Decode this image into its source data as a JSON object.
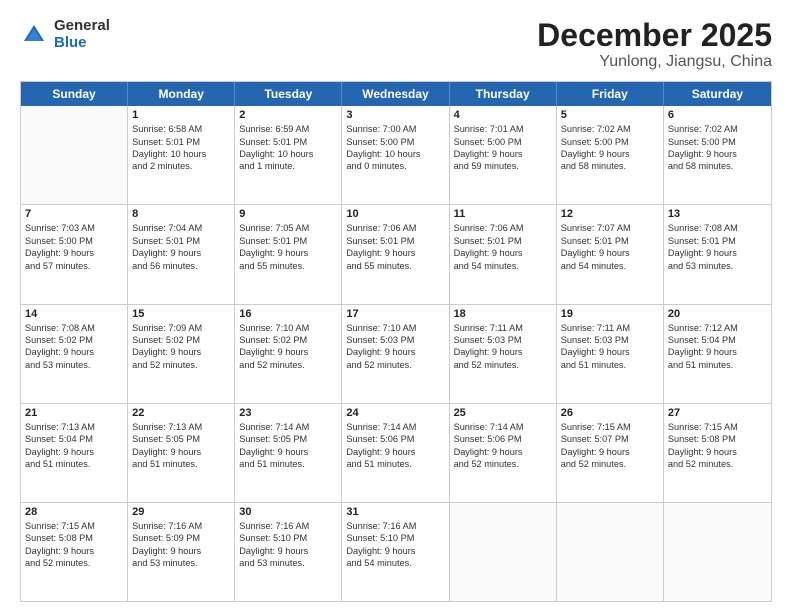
{
  "logo": {
    "general": "General",
    "blue": "Blue"
  },
  "title": "December 2025",
  "subtitle": "Yunlong, Jiangsu, China",
  "weekdays": [
    "Sunday",
    "Monday",
    "Tuesday",
    "Wednesday",
    "Thursday",
    "Friday",
    "Saturday"
  ],
  "weeks": [
    [
      {
        "day": "",
        "lines": []
      },
      {
        "day": "1",
        "lines": [
          "Sunrise: 6:58 AM",
          "Sunset: 5:01 PM",
          "Daylight: 10 hours",
          "and 2 minutes."
        ]
      },
      {
        "day": "2",
        "lines": [
          "Sunrise: 6:59 AM",
          "Sunset: 5:01 PM",
          "Daylight: 10 hours",
          "and 1 minute."
        ]
      },
      {
        "day": "3",
        "lines": [
          "Sunrise: 7:00 AM",
          "Sunset: 5:00 PM",
          "Daylight: 10 hours",
          "and 0 minutes."
        ]
      },
      {
        "day": "4",
        "lines": [
          "Sunrise: 7:01 AM",
          "Sunset: 5:00 PM",
          "Daylight: 9 hours",
          "and 59 minutes."
        ]
      },
      {
        "day": "5",
        "lines": [
          "Sunrise: 7:02 AM",
          "Sunset: 5:00 PM",
          "Daylight: 9 hours",
          "and 58 minutes."
        ]
      },
      {
        "day": "6",
        "lines": [
          "Sunrise: 7:02 AM",
          "Sunset: 5:00 PM",
          "Daylight: 9 hours",
          "and 58 minutes."
        ]
      }
    ],
    [
      {
        "day": "7",
        "lines": [
          "Sunrise: 7:03 AM",
          "Sunset: 5:00 PM",
          "Daylight: 9 hours",
          "and 57 minutes."
        ]
      },
      {
        "day": "8",
        "lines": [
          "Sunrise: 7:04 AM",
          "Sunset: 5:01 PM",
          "Daylight: 9 hours",
          "and 56 minutes."
        ]
      },
      {
        "day": "9",
        "lines": [
          "Sunrise: 7:05 AM",
          "Sunset: 5:01 PM",
          "Daylight: 9 hours",
          "and 55 minutes."
        ]
      },
      {
        "day": "10",
        "lines": [
          "Sunrise: 7:06 AM",
          "Sunset: 5:01 PM",
          "Daylight: 9 hours",
          "and 55 minutes."
        ]
      },
      {
        "day": "11",
        "lines": [
          "Sunrise: 7:06 AM",
          "Sunset: 5:01 PM",
          "Daylight: 9 hours",
          "and 54 minutes."
        ]
      },
      {
        "day": "12",
        "lines": [
          "Sunrise: 7:07 AM",
          "Sunset: 5:01 PM",
          "Daylight: 9 hours",
          "and 54 minutes."
        ]
      },
      {
        "day": "13",
        "lines": [
          "Sunrise: 7:08 AM",
          "Sunset: 5:01 PM",
          "Daylight: 9 hours",
          "and 53 minutes."
        ]
      }
    ],
    [
      {
        "day": "14",
        "lines": [
          "Sunrise: 7:08 AM",
          "Sunset: 5:02 PM",
          "Daylight: 9 hours",
          "and 53 minutes."
        ]
      },
      {
        "day": "15",
        "lines": [
          "Sunrise: 7:09 AM",
          "Sunset: 5:02 PM",
          "Daylight: 9 hours",
          "and 52 minutes."
        ]
      },
      {
        "day": "16",
        "lines": [
          "Sunrise: 7:10 AM",
          "Sunset: 5:02 PM",
          "Daylight: 9 hours",
          "and 52 minutes."
        ]
      },
      {
        "day": "17",
        "lines": [
          "Sunrise: 7:10 AM",
          "Sunset: 5:03 PM",
          "Daylight: 9 hours",
          "and 52 minutes."
        ]
      },
      {
        "day": "18",
        "lines": [
          "Sunrise: 7:11 AM",
          "Sunset: 5:03 PM",
          "Daylight: 9 hours",
          "and 52 minutes."
        ]
      },
      {
        "day": "19",
        "lines": [
          "Sunrise: 7:11 AM",
          "Sunset: 5:03 PM",
          "Daylight: 9 hours",
          "and 51 minutes."
        ]
      },
      {
        "day": "20",
        "lines": [
          "Sunrise: 7:12 AM",
          "Sunset: 5:04 PM",
          "Daylight: 9 hours",
          "and 51 minutes."
        ]
      }
    ],
    [
      {
        "day": "21",
        "lines": [
          "Sunrise: 7:13 AM",
          "Sunset: 5:04 PM",
          "Daylight: 9 hours",
          "and 51 minutes."
        ]
      },
      {
        "day": "22",
        "lines": [
          "Sunrise: 7:13 AM",
          "Sunset: 5:05 PM",
          "Daylight: 9 hours",
          "and 51 minutes."
        ]
      },
      {
        "day": "23",
        "lines": [
          "Sunrise: 7:14 AM",
          "Sunset: 5:05 PM",
          "Daylight: 9 hours",
          "and 51 minutes."
        ]
      },
      {
        "day": "24",
        "lines": [
          "Sunrise: 7:14 AM",
          "Sunset: 5:06 PM",
          "Daylight: 9 hours",
          "and 51 minutes."
        ]
      },
      {
        "day": "25",
        "lines": [
          "Sunrise: 7:14 AM",
          "Sunset: 5:06 PM",
          "Daylight: 9 hours",
          "and 52 minutes."
        ]
      },
      {
        "day": "26",
        "lines": [
          "Sunrise: 7:15 AM",
          "Sunset: 5:07 PM",
          "Daylight: 9 hours",
          "and 52 minutes."
        ]
      },
      {
        "day": "27",
        "lines": [
          "Sunrise: 7:15 AM",
          "Sunset: 5:08 PM",
          "Daylight: 9 hours",
          "and 52 minutes."
        ]
      }
    ],
    [
      {
        "day": "28",
        "lines": [
          "Sunrise: 7:15 AM",
          "Sunset: 5:08 PM",
          "Daylight: 9 hours",
          "and 52 minutes."
        ]
      },
      {
        "day": "29",
        "lines": [
          "Sunrise: 7:16 AM",
          "Sunset: 5:09 PM",
          "Daylight: 9 hours",
          "and 53 minutes."
        ]
      },
      {
        "day": "30",
        "lines": [
          "Sunrise: 7:16 AM",
          "Sunset: 5:10 PM",
          "Daylight: 9 hours",
          "and 53 minutes."
        ]
      },
      {
        "day": "31",
        "lines": [
          "Sunrise: 7:16 AM",
          "Sunset: 5:10 PM",
          "Daylight: 9 hours",
          "and 54 minutes."
        ]
      },
      {
        "day": "",
        "lines": []
      },
      {
        "day": "",
        "lines": []
      },
      {
        "day": "",
        "lines": []
      }
    ]
  ]
}
